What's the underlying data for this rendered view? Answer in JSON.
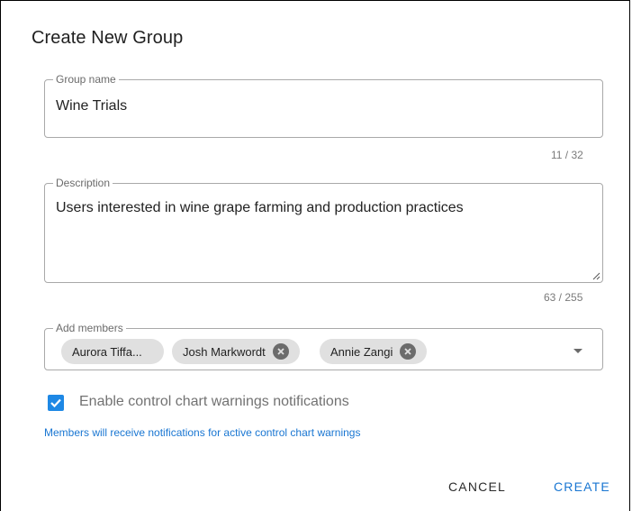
{
  "dialog": {
    "title": "Create New Group"
  },
  "group_name": {
    "label": "Group name",
    "value": "Wine Trials",
    "counter": "11 / 32"
  },
  "description": {
    "label": "Description",
    "value": "Users interested in wine grape farming and production practices",
    "counter": "63 / 255"
  },
  "members": {
    "label": "Add members",
    "chips": [
      {
        "label": "Aurora Tiffa..."
      },
      {
        "label": "Josh Markwordt"
      },
      {
        "label": "Annie Zangi"
      }
    ]
  },
  "notifications": {
    "checked": true,
    "label": "Enable control chart warnings notifications",
    "hint": "Members will receive notifications for active control chart warnings"
  },
  "actions": {
    "cancel": "CANCEL",
    "create": "CREATE"
  },
  "colors": {
    "accent": "#1976d2",
    "checkbox": "#1e88e5",
    "chip_bg": "#e0e0e0"
  }
}
